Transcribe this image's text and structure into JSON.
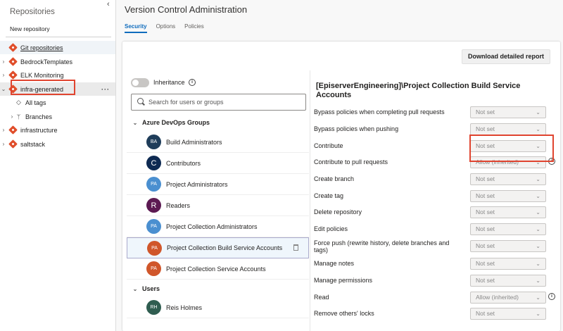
{
  "sidebar": {
    "title": "Repositories",
    "collapse_icon": "chevron-left-icon",
    "new_repository": "New repository",
    "items": [
      {
        "label": "Git repositories",
        "icon": "git-icon"
      },
      {
        "label": "BedrockTemplates",
        "icon": "git-icon"
      },
      {
        "label": "ELK Monitoring",
        "icon": "git-icon"
      },
      {
        "label": "infra-generated",
        "icon": "git-icon"
      },
      {
        "label": "All tags",
        "icon": "tag-icon"
      },
      {
        "label": "Branches",
        "icon": "branch-icon"
      },
      {
        "label": "infrastructure",
        "icon": "git-icon"
      },
      {
        "label": "saltstack",
        "icon": "git-icon"
      }
    ],
    "more": "···"
  },
  "header": {
    "title": "Version Control Administration",
    "tabs": [
      {
        "label": "Security",
        "active": true
      },
      {
        "label": "Options",
        "active": false
      },
      {
        "label": "Policies",
        "active": false
      }
    ]
  },
  "toolbar": {
    "download_label": "Download detailed report"
  },
  "left": {
    "inheritance_label": "Inheritance",
    "search_placeholder": "Search for users or groups",
    "groups_header": "Azure DevOps Groups",
    "users_header": "Users",
    "groups": [
      {
        "initials": "BA",
        "name": "Build Administrators",
        "color": "#1f3d5a"
      },
      {
        "initials": "C",
        "name": "Contributors",
        "color": "#0e2a52"
      },
      {
        "initials": "PA",
        "name": "Project Administrators",
        "color": "#4a8fd0"
      },
      {
        "initials": "R",
        "name": "Readers",
        "color": "#5c1a52"
      },
      {
        "initials": "PA",
        "name": "Project Collection Administrators",
        "color": "#4a8fd0"
      },
      {
        "initials": "PA",
        "name": "Project Collection Build Service Accounts",
        "color": "#d0562a"
      },
      {
        "initials": "PA",
        "name": "Project Collection Service Accounts",
        "color": "#d0562a"
      }
    ],
    "users": [
      {
        "initials": "RH",
        "name": "Reis Holmes",
        "color": "#2f5d50"
      }
    ]
  },
  "right": {
    "title": "[EpiserverEngineering]\\Project Collection Build Service Accounts",
    "permissions": [
      {
        "label": "Bypass policies when completing pull requests",
        "value": "Not set",
        "info": false
      },
      {
        "label": "Bypass policies when pushing",
        "value": "Not set",
        "info": false
      },
      {
        "label": "Contribute",
        "value": "Not set",
        "info": false
      },
      {
        "label": "Contribute to pull requests",
        "value": "Allow (inherited)",
        "info": true
      },
      {
        "label": "Create branch",
        "value": "Not set",
        "info": false
      },
      {
        "label": "Create tag",
        "value": "Not set",
        "info": false
      },
      {
        "label": "Delete repository",
        "value": "Not set",
        "info": false
      },
      {
        "label": "Edit policies",
        "value": "Not set",
        "info": false
      },
      {
        "label": "Force push (rewrite history, delete branches and tags)",
        "value": "Not set",
        "info": false
      },
      {
        "label": "Manage notes",
        "value": "Not set",
        "info": false
      },
      {
        "label": "Manage permissions",
        "value": "Not set",
        "info": false
      },
      {
        "label": "Read",
        "value": "Allow (inherited)",
        "info": true
      },
      {
        "label": "Remove others' locks",
        "value": "Not set",
        "info": false
      }
    ]
  },
  "colors": {
    "accent": "#0f6cbd",
    "git": "#e04e2b",
    "highlight": "#e0442f"
  }
}
